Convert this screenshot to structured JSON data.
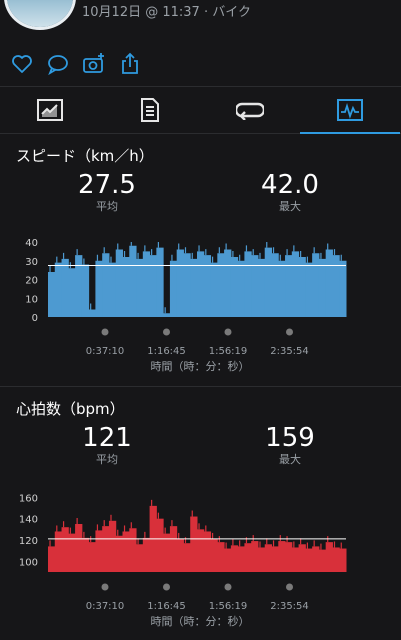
{
  "header": {
    "subtitle": "10月12日 @ 11:37 · バイク"
  },
  "actions": {
    "like": "heart-icon",
    "comment": "comment-icon",
    "photo": "camera-add-icon",
    "share": "share-icon"
  },
  "tabs": [
    {
      "icon": "chart-card-icon",
      "active": false
    },
    {
      "icon": "document-list-icon",
      "active": false
    },
    {
      "icon": "laps-icon",
      "active": false
    },
    {
      "icon": "graph-icon",
      "active": true
    }
  ],
  "speed": {
    "title": "スピード（km／h）",
    "avg_value": "27.5",
    "avg_label": "平均",
    "max_value": "42.0",
    "max_label": "最大"
  },
  "heart": {
    "title": "心拍数（bpm）",
    "avg_value": "121",
    "avg_label": "平均",
    "max_value": "159",
    "max_label": "最大"
  },
  "chart_data": [
    {
      "type": "area",
      "color": "#4d9ad1",
      "avg_line": 27.5,
      "yticks": [
        "40",
        "30",
        "20",
        "10",
        "0"
      ],
      "ylim": [
        0,
        40
      ],
      "xticks": [
        "0:37:10",
        "1:16:45",
        "1:56:19",
        "2:35:54"
      ],
      "xlabel": "時間（時：分：秒）",
      "x": [
        0,
        240,
        480,
        720,
        960,
        1200,
        1440,
        1680,
        1920,
        2160,
        2400,
        2640,
        2880,
        3120,
        3360,
        3600,
        3840,
        4080,
        4320,
        4560,
        4800,
        5040,
        5280,
        5520,
        5760,
        6000,
        6240,
        6480,
        6720,
        6960,
        7200,
        7440,
        7680,
        7920,
        8160,
        8400,
        8640,
        8880,
        9120,
        9360,
        9600,
        9840,
        10080,
        10320
      ],
      "values": [
        24,
        29,
        31,
        26,
        33,
        28,
        4,
        30,
        34,
        29,
        36,
        32,
        38,
        31,
        35,
        33,
        37,
        2,
        30,
        36,
        34,
        31,
        35,
        33,
        29,
        34,
        36,
        32,
        30,
        35,
        33,
        31,
        37,
        34,
        30,
        33,
        35,
        32,
        29,
        34,
        31,
        36,
        33,
        30
      ]
    },
    {
      "type": "area",
      "color": "#d8303a",
      "avg_line": 121,
      "yticks": [
        "160",
        "140",
        "120",
        "100"
      ],
      "ylim": [
        90,
        165
      ],
      "xticks": [
        "0:37:10",
        "1:16:45",
        "1:56:19",
        "2:35:54"
      ],
      "xlabel": "時間（時：分：秒）",
      "x": [
        0,
        240,
        480,
        720,
        960,
        1200,
        1440,
        1680,
        1920,
        2160,
        2400,
        2640,
        2880,
        3120,
        3360,
        3600,
        3840,
        4080,
        4320,
        4560,
        4800,
        5040,
        5280,
        5520,
        5760,
        6000,
        6240,
        6480,
        6720,
        6960,
        7200,
        7440,
        7680,
        7920,
        8160,
        8400,
        8640,
        8880,
        9120,
        9360,
        9600,
        9840,
        10080,
        10320
      ],
      "values": [
        114,
        128,
        132,
        126,
        135,
        122,
        118,
        129,
        133,
        138,
        124,
        128,
        131,
        116,
        122,
        152,
        140,
        126,
        133,
        121,
        117,
        142,
        130,
        128,
        121,
        118,
        112,
        115,
        114,
        117,
        119,
        113,
        116,
        114,
        119,
        118,
        113,
        116,
        112,
        114,
        111,
        118,
        113,
        112
      ]
    }
  ]
}
